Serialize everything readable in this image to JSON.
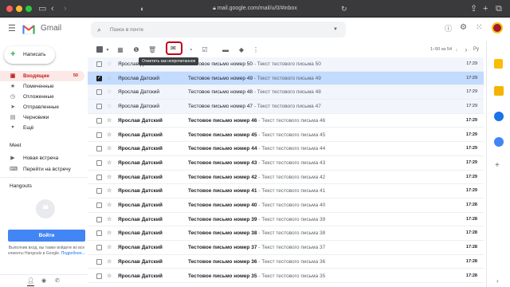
{
  "browser": {
    "url": "mail.google.com/mail/u/0/#inbox",
    "colors": {
      "close": "#ff5f57",
      "minimize": "#febc2e",
      "zoom": "#28c840"
    }
  },
  "app": {
    "name": "Gmail"
  },
  "search": {
    "placeholder": "Поиск в почте"
  },
  "compose": {
    "label": "Написать"
  },
  "nav": {
    "items": [
      {
        "label": "Входящие",
        "count": "50",
        "icon": "inbox-icon",
        "active": true
      },
      {
        "label": "Помеченные",
        "count": "",
        "icon": "star-icon",
        "active": false
      },
      {
        "label": "Отложенные",
        "count": "",
        "icon": "clock-icon",
        "active": false
      },
      {
        "label": "Отправленные",
        "count": "",
        "icon": "send-icon",
        "active": false
      },
      {
        "label": "Черновики",
        "count": "",
        "icon": "draft-icon",
        "active": false
      },
      {
        "label": "Ещё",
        "count": "",
        "icon": "chevron-down-icon",
        "active": false
      }
    ]
  },
  "meet": {
    "title": "Meet",
    "items": [
      {
        "label": "Новая встреча",
        "icon": "video-icon"
      },
      {
        "label": "Перейти на встречу",
        "icon": "keyboard-icon"
      }
    ]
  },
  "hangouts": {
    "title": "Hangouts",
    "signin_label": "Войти",
    "info_text": "Выполнив вход, вы также войдете во все клиенты Hangouts в Google.",
    "more_link": "Подробнее..."
  },
  "toolbar": {
    "tooltip": "Отметить как непрочитанное",
    "pagination": "1–50 из 54",
    "lang": "Ру"
  },
  "messages": [
    {
      "sender": "Ярослав Датский",
      "subject": "Тестовое письмо номер 50",
      "snippet": " - Текст тестового письма 50",
      "time": "17:29",
      "unread": false,
      "selected": false
    },
    {
      "sender": "Ярослав Датский",
      "subject": "Тестовое письмо номер 49",
      "snippet": " - Текст тестового письма 49",
      "time": "17:29",
      "unread": false,
      "selected": true
    },
    {
      "sender": "Ярослав Датский",
      "subject": "Тестовое письмо номер 48",
      "snippet": " - Текст тестового письма 48",
      "time": "17:29",
      "unread": false,
      "selected": false
    },
    {
      "sender": "Ярослав Датский",
      "subject": "Тестовое письмо номер 47",
      "snippet": " - Текст тестового письма 47",
      "time": "17:29",
      "unread": false,
      "selected": false
    },
    {
      "sender": "Ярослав Датский",
      "subject": "Тестовое письмо номер 46",
      "snippet": " - Текст тестового письма 46",
      "time": "17:29",
      "unread": true,
      "selected": false
    },
    {
      "sender": "Ярослав Датский",
      "subject": "Тестовое письмо номер 45",
      "snippet": " - Текст тестового письма 45",
      "time": "17:29",
      "unread": true,
      "selected": false
    },
    {
      "sender": "Ярослав Датский",
      "subject": "Тестовое письмо номер 44",
      "snippet": " - Текст тестового письма 44",
      "time": "17:29",
      "unread": true,
      "selected": false
    },
    {
      "sender": "Ярослав Датский",
      "subject": "Тестовое письмо номер 43",
      "snippet": " - Текст тестового письма 43",
      "time": "17:29",
      "unread": true,
      "selected": false
    },
    {
      "sender": "Ярослав Датский",
      "subject": "Тестовое письмо номер 42",
      "snippet": " - Текст тестового письма 42",
      "time": "17:29",
      "unread": true,
      "selected": false
    },
    {
      "sender": "Ярослав Датский",
      "subject": "Тестовое письмо номер 41",
      "snippet": " - Текст тестового письма 41",
      "time": "17:29",
      "unread": true,
      "selected": false
    },
    {
      "sender": "Ярослав Датский",
      "subject": "Тестовое письмо номер 40",
      "snippet": " - Текст тестового письма 40",
      "time": "17:28",
      "unread": true,
      "selected": false
    },
    {
      "sender": "Ярослав Датский",
      "subject": "Тестовое письмо номер 39",
      "snippet": " - Текст тестового письма 39",
      "time": "17:28",
      "unread": true,
      "selected": false
    },
    {
      "sender": "Ярослав Датский",
      "subject": "Тестовое письмо номер 38",
      "snippet": " - Текст тестового письма 38",
      "time": "17:28",
      "unread": true,
      "selected": false
    },
    {
      "sender": "Ярослав Датский",
      "subject": "Тестовое письмо номер 37",
      "snippet": " - Текст тестового письма 37",
      "time": "17:28",
      "unread": true,
      "selected": false
    },
    {
      "sender": "Ярослав Датский",
      "subject": "Тестовое письмо номер 36",
      "snippet": " - Текст тестового письма 36",
      "time": "17:28",
      "unread": true,
      "selected": false
    },
    {
      "sender": "Ярослав Датский",
      "subject": "Тестовое письмо номер 35",
      "snippet": " - Текст тестового письма 35",
      "time": "17:28",
      "unread": true,
      "selected": false
    }
  ]
}
